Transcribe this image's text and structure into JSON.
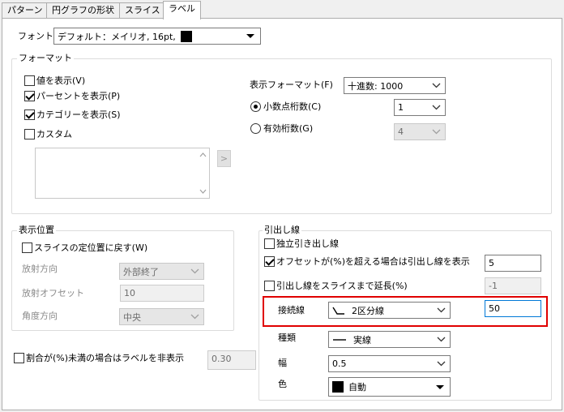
{
  "tabs": [
    "パターン",
    "円グラフの形状",
    "スライス",
    "ラベル"
  ],
  "active_tab": "ラベル",
  "font": {
    "label": "フォント",
    "value": "デフォルト：メイリオ, 16pt,",
    "color": "#000000"
  },
  "format_group": {
    "title": "フォーマット",
    "checkboxes": [
      {
        "label": "値を表示(V)",
        "checked": false
      },
      {
        "label": "パーセントを表示(P)",
        "checked": true
      },
      {
        "label": "カテゴリーを表示(S)",
        "checked": true
      },
      {
        "label": "カスタム",
        "checked": false
      }
    ],
    "custom_arrow_label": ">",
    "display_format": {
      "label": "表示フォーマット(F)",
      "value": "十進数: 1000"
    },
    "decimal_places": {
      "label": "小数点桁数(C)",
      "value": "1",
      "selected": true
    },
    "significant_digits": {
      "label": "有効桁数(G)",
      "value": "4",
      "selected": false
    }
  },
  "position_group": {
    "title": "表示位置",
    "reset_checkbox": {
      "label": "スライスの定位置に戻す(W)",
      "checked": false
    },
    "radial_direction": {
      "label": "放射方向",
      "value": "外部終了"
    },
    "radial_offset": {
      "label": "放射オフセット",
      "value": "10"
    },
    "angle_direction": {
      "label": "角度方向",
      "value": "中央"
    }
  },
  "hide_label": {
    "label": "割合が(%)未満の場合はラベルを非表示",
    "checked": false,
    "value": "0.30"
  },
  "leader_group": {
    "title": "引出し線",
    "independent": {
      "label": "独立引き出し線",
      "checked": false
    },
    "offset_show": {
      "label": "オフセットが(%)を超える場合は引出し線を表示",
      "checked": true,
      "value": "5"
    },
    "extend": {
      "label": "引出し線をスライスまで延長(%)",
      "checked": false,
      "value": "-1"
    },
    "connector": {
      "label": "接続線",
      "value": "2区分線",
      "input_value": "50"
    },
    "type": {
      "label": "種類",
      "value": "実線"
    },
    "width": {
      "label": "幅",
      "value": "0.5"
    },
    "color": {
      "label": "色",
      "value": "自動",
      "swatch": "#000000"
    }
  },
  "highlight_color": "#e00000"
}
